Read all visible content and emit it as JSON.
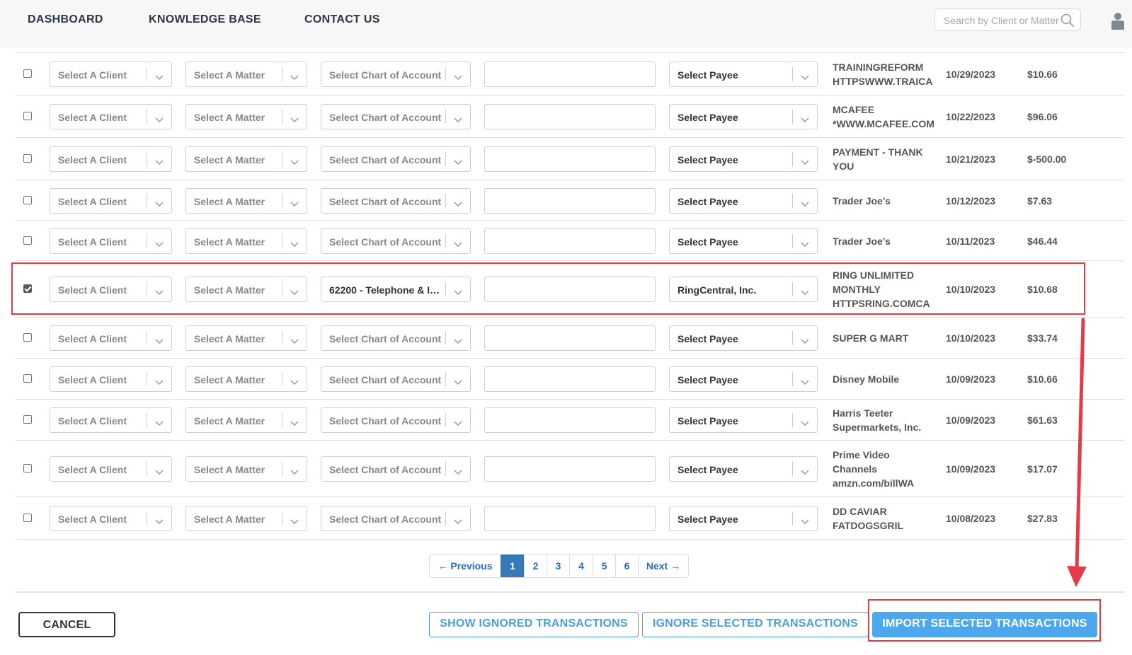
{
  "nav": {
    "items": [
      "DASHBOARD",
      "KNOWLEDGE BASE",
      "CONTACT US"
    ],
    "search_placeholder": "Search by Client or Matter"
  },
  "rows": [
    {
      "checked": false,
      "client": "Select A Client",
      "matter": "Select A Matter",
      "account": "Select Chart of Account",
      "memo": "",
      "payee": "Select Payee",
      "desc": [
        "TRAININGREFORM",
        "HTTPSWWW.TRAICA"
      ],
      "date": "10/29/2023",
      "amount": "$10.66"
    },
    {
      "checked": false,
      "client": "Select A Client",
      "matter": "Select A Matter",
      "account": "Select Chart of Account",
      "memo": "",
      "payee": "Select Payee",
      "desc": [
        "MCAFEE",
        "*WWW.MCAFEE.COM"
      ],
      "date": "10/22/2023",
      "amount": "$96.06"
    },
    {
      "checked": false,
      "client": "Select A Client",
      "matter": "Select A Matter",
      "account": "Select Chart of Account",
      "memo": "",
      "payee": "Select Payee",
      "desc": [
        "PAYMENT - THANK",
        "YOU"
      ],
      "date": "10/21/2023",
      "amount": "$-500.00"
    },
    {
      "checked": false,
      "client": "Select A Client",
      "matter": "Select A Matter",
      "account": "Select Chart of Account",
      "memo": "",
      "payee": "Select Payee",
      "desc": [
        "Trader Joe's"
      ],
      "date": "10/12/2023",
      "amount": "$7.63"
    },
    {
      "checked": false,
      "client": "Select A Client",
      "matter": "Select A Matter",
      "account": "Select Chart of Account",
      "memo": "",
      "payee": "Select Payee",
      "desc": [
        "Trader Joe's"
      ],
      "date": "10/11/2023",
      "amount": "$46.44"
    },
    {
      "checked": true,
      "client": "Select A Client",
      "matter": "Select A Matter",
      "account": "62200 - Telephone & In...",
      "memo": "",
      "payee": "RingCentral, Inc.",
      "desc": [
        "RING UNLIMITED",
        "MONTHLY",
        "HTTPSRING.COMCA"
      ],
      "date": "10/10/2023",
      "amount": "$10.68"
    },
    {
      "checked": false,
      "client": "Select A Client",
      "matter": "Select A Matter",
      "account": "Select Chart of Account",
      "memo": "",
      "payee": "Select Payee",
      "desc": [
        "SUPER G MART"
      ],
      "date": "10/10/2023",
      "amount": "$33.74"
    },
    {
      "checked": false,
      "client": "Select A Client",
      "matter": "Select A Matter",
      "account": "Select Chart of Account",
      "memo": "",
      "payee": "Select Payee",
      "desc": [
        "Disney Mobile"
      ],
      "date": "10/09/2023",
      "amount": "$10.66"
    },
    {
      "checked": false,
      "client": "Select A Client",
      "matter": "Select A Matter",
      "account": "Select Chart of Account",
      "memo": "",
      "payee": "Select Payee",
      "desc": [
        "Harris Teeter",
        "Supermarkets, Inc."
      ],
      "date": "10/09/2023",
      "amount": "$61.63"
    },
    {
      "checked": false,
      "client": "Select A Client",
      "matter": "Select A Matter",
      "account": "Select Chart of Account",
      "memo": "",
      "payee": "Select Payee",
      "desc": [
        "Prime Video",
        "Channels",
        "amzn.com/billWA"
      ],
      "date": "10/09/2023",
      "amount": "$17.07"
    },
    {
      "checked": false,
      "client": "Select A Client",
      "matter": "Select A Matter",
      "account": "Select Chart of Account",
      "memo": "",
      "payee": "Select Payee",
      "desc": [
        "DD CAVIAR",
        "FATDOGSGRIL"
      ],
      "date": "10/08/2023",
      "amount": "$27.83"
    }
  ],
  "pagination": {
    "previous": "← Previous",
    "pages": [
      "1",
      "2",
      "3",
      "4",
      "5",
      "6"
    ],
    "active_page": "1",
    "next": "Next →"
  },
  "footer": {
    "cancel": "CANCEL",
    "show_ignored": "SHOW IGNORED TRANSACTIONS",
    "ignore_selected": "IGNORE SELECTED TRANSACTIONS",
    "import_selected": "IMPORT SELECTED TRANSACTIONS"
  },
  "colors": {
    "primary": "#4ca7ec",
    "highlight": "#e53b46",
    "active_page": "#337ab7"
  }
}
